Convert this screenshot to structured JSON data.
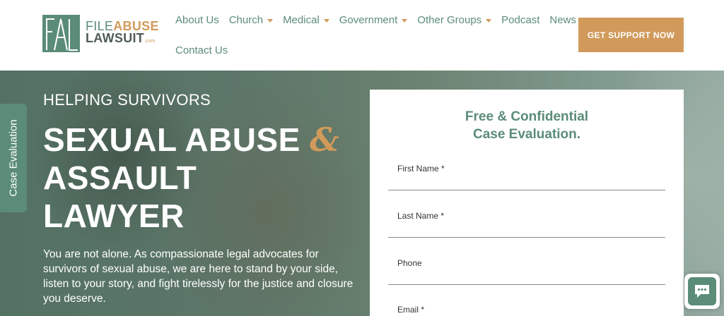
{
  "brand": {
    "logo_line1_a": "FILE",
    "logo_line1_b": "ABUSE",
    "logo_line2": "LAWSUIT",
    "logo_suffix": ".com",
    "monogram": "FAL"
  },
  "nav": {
    "items": [
      {
        "label": "About Us",
        "dropdown": false
      },
      {
        "label": "Church",
        "dropdown": true
      },
      {
        "label": "Medical",
        "dropdown": true
      },
      {
        "label": "Government",
        "dropdown": true
      },
      {
        "label": "Other Groups",
        "dropdown": true
      },
      {
        "label": "Podcast",
        "dropdown": false
      },
      {
        "label": "News",
        "dropdown": false
      },
      {
        "label": "Contact Us",
        "dropdown": false
      }
    ],
    "cta": "GET SUPPORT NOW"
  },
  "side_tab": "Case Evaluation",
  "hero": {
    "kicker": "HELPING SURVIVORS",
    "title_line1": "SEXUAL ABUSE ",
    "title_amp": "&",
    "title_line2": "ASSAULT",
    "title_line3": "LAWYER",
    "body": "You are not alone. As compassionate legal advocates for survivors of sexual abuse, we are here to stand by your side, listen to your story, and fight tirelessly for the justice and closure you deserve."
  },
  "form": {
    "title_line1": "Free & Confidential",
    "title_line2": "Case Evaluation.",
    "fields": [
      {
        "label": "First Name *"
      },
      {
        "label": "Last Name *"
      },
      {
        "label": "Phone"
      },
      {
        "label": "Email *"
      }
    ]
  },
  "colors": {
    "accent_green": "#5b8c78",
    "accent_gold": "#d19a5b"
  },
  "icons": {
    "chat": "chat-bubble-icon"
  }
}
